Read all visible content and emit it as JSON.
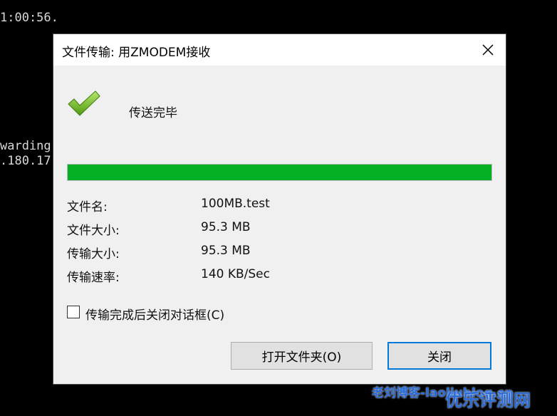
{
  "terminal": {
    "line1": "1:00:56.",
    "line2": "warding",
    "line3": ".180.17"
  },
  "dialog": {
    "title": "文件传输: 用ZMODEM接收",
    "status": "传送完毕",
    "progress": 1.0,
    "progress_color": "#06b025",
    "info": [
      {
        "label": "文件名:",
        "value": "100MB.test"
      },
      {
        "label": "文件大小:",
        "value": "95.3 MB"
      },
      {
        "label": "传输大小:",
        "value": "95.3 MB"
      },
      {
        "label": "传输速率:",
        "value": "140 KB/Sec"
      }
    ],
    "checkbox_label": "传输完成后关闭对话框(C)",
    "checkbox_checked": false,
    "open_folder_button": "打开文件夹(O)",
    "close_button": "关闭",
    "icons": {
      "status": "checkmark-icon",
      "close": "close-icon"
    }
  },
  "watermark": {
    "text1": "老刘博客-laoliublog.cn",
    "text2": "优乐评测网"
  }
}
